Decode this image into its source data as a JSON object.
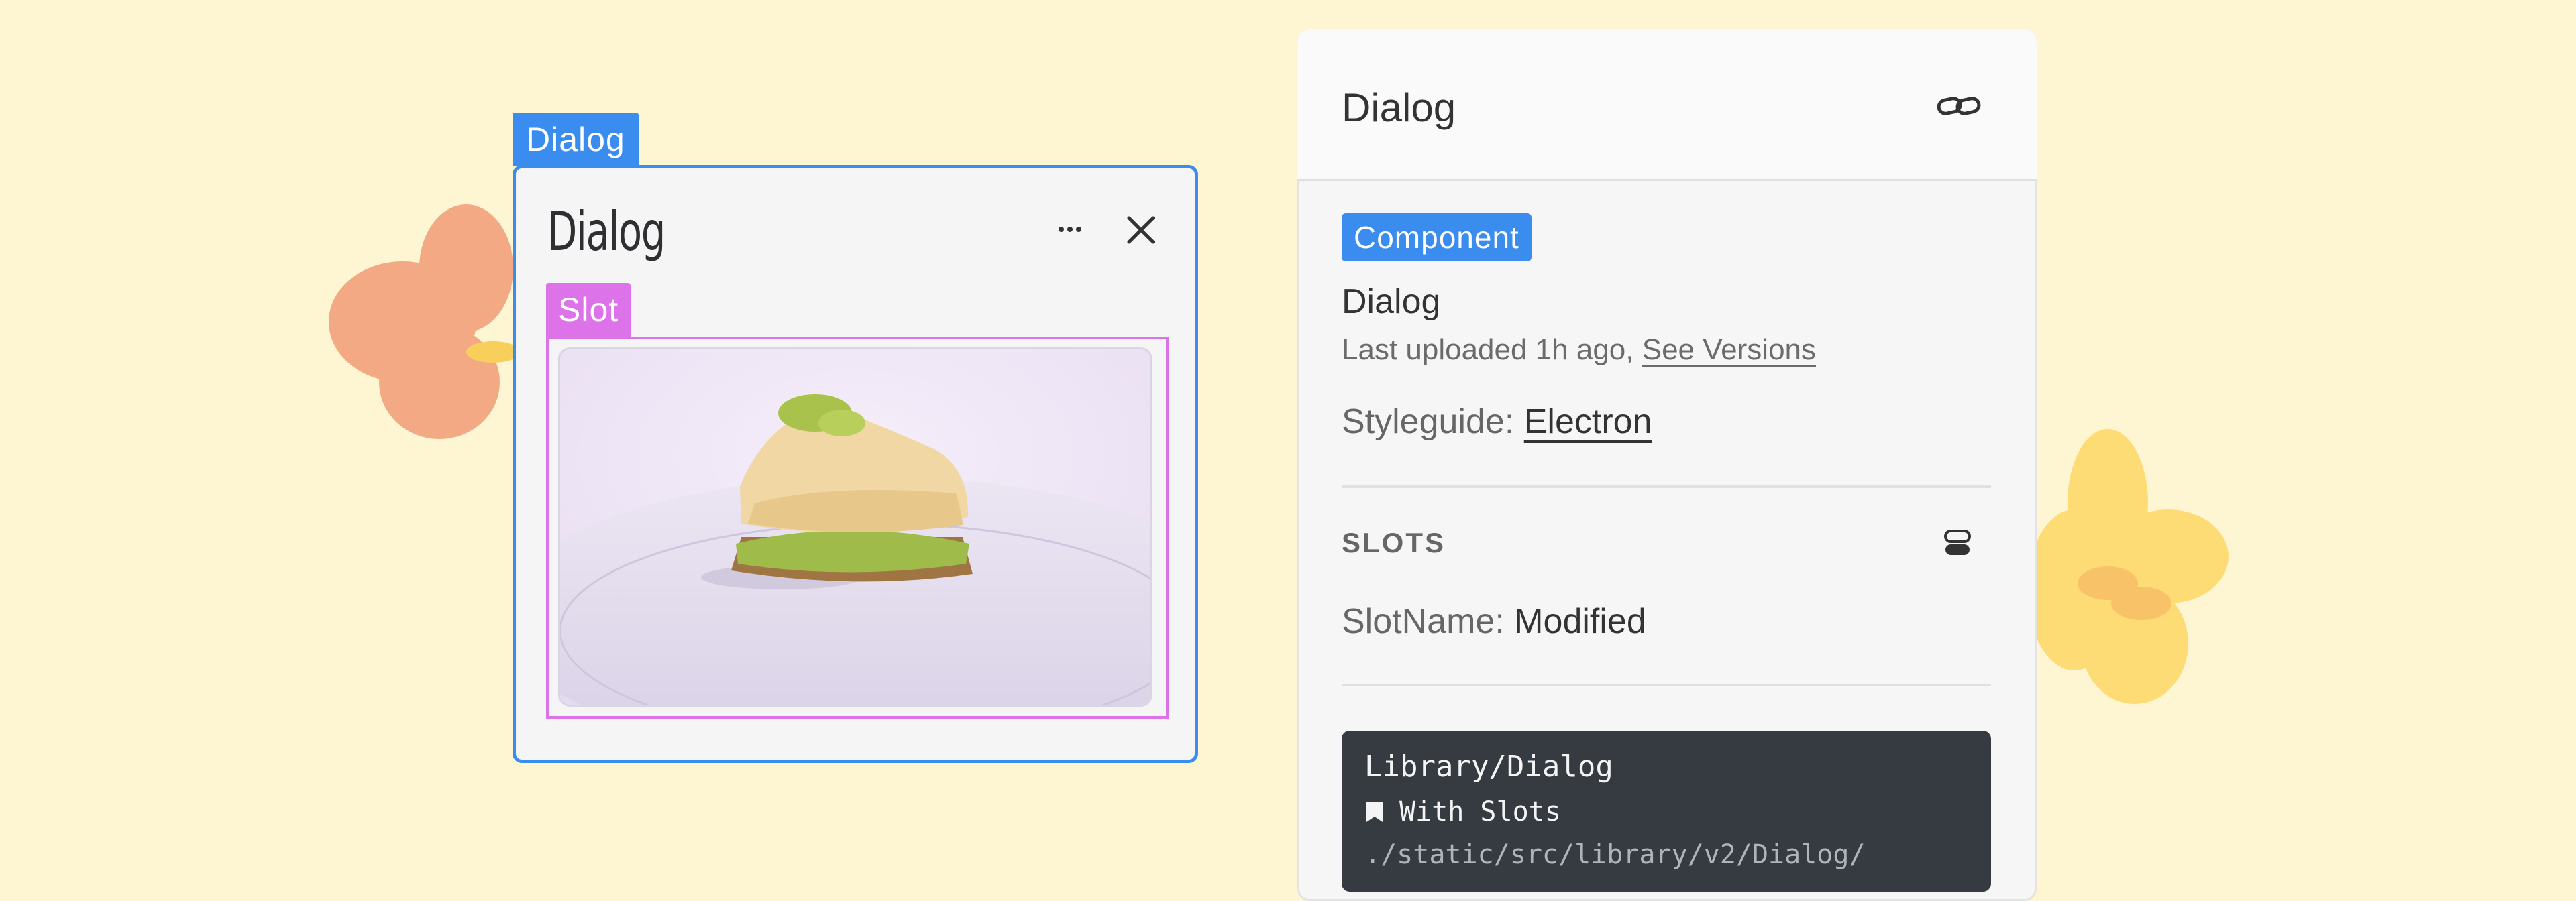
{
  "canvas": {
    "background": "#fef5d2"
  },
  "preview": {
    "component_tag": "Dialog",
    "title": "Dialog",
    "more_icon": "ellipsis-icon",
    "close_icon": "close-icon",
    "slot_tag": "Slot",
    "image_subject": "baklava-photo"
  },
  "panel": {
    "title": "Dialog",
    "link_icon": "link-icon",
    "badge": "Component",
    "component_name": "Dialog",
    "uploaded_prefix": "Last uploaded 1h ago,",
    "uploaded_link": "See Versions",
    "styleguide_label": "Styleguide:",
    "styleguide_value": "Electron",
    "slots_heading": "SLOTS",
    "slot_label": "SlotName:",
    "slot_value": "Modified",
    "code": {
      "path": "Library/Dialog",
      "story": "With Slots",
      "file": "./static/src/library/v2/Dialog/"
    }
  },
  "colors": {
    "accent_blue": "#3a8dee",
    "slot_pink": "#dc73e8",
    "code_bg": "#363b42"
  }
}
